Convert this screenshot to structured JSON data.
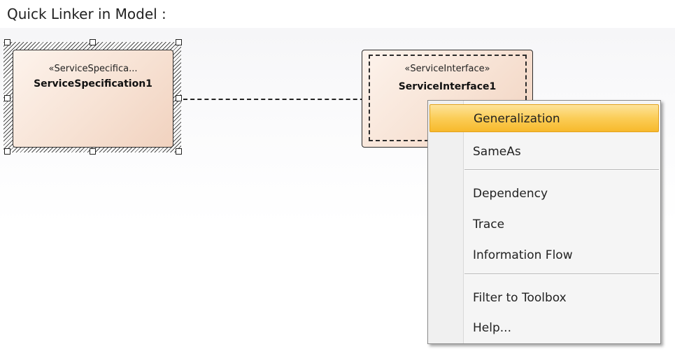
{
  "header": {
    "title": "Quick Linker in Model :"
  },
  "diagram": {
    "source_element": {
      "stereotype": "«ServiceSpecifica...",
      "name": "ServiceSpecification1"
    },
    "target_element": {
      "stereotype": "«ServiceInterface»",
      "name": "ServiceInterface1"
    }
  },
  "context_menu": {
    "items": [
      {
        "label": "Generalization",
        "highlighted": true
      },
      {
        "label": "SameAs"
      },
      {
        "label": "Dependency"
      },
      {
        "label": "Trace"
      },
      {
        "label": "Information Flow"
      },
      {
        "label": "Filter to Toolbox"
      },
      {
        "label": "Help..."
      }
    ]
  },
  "colors": {
    "element_fill": "#f7e2d4",
    "menu_highlight": "#fbcd57",
    "menu_background": "#f5f5f5"
  }
}
